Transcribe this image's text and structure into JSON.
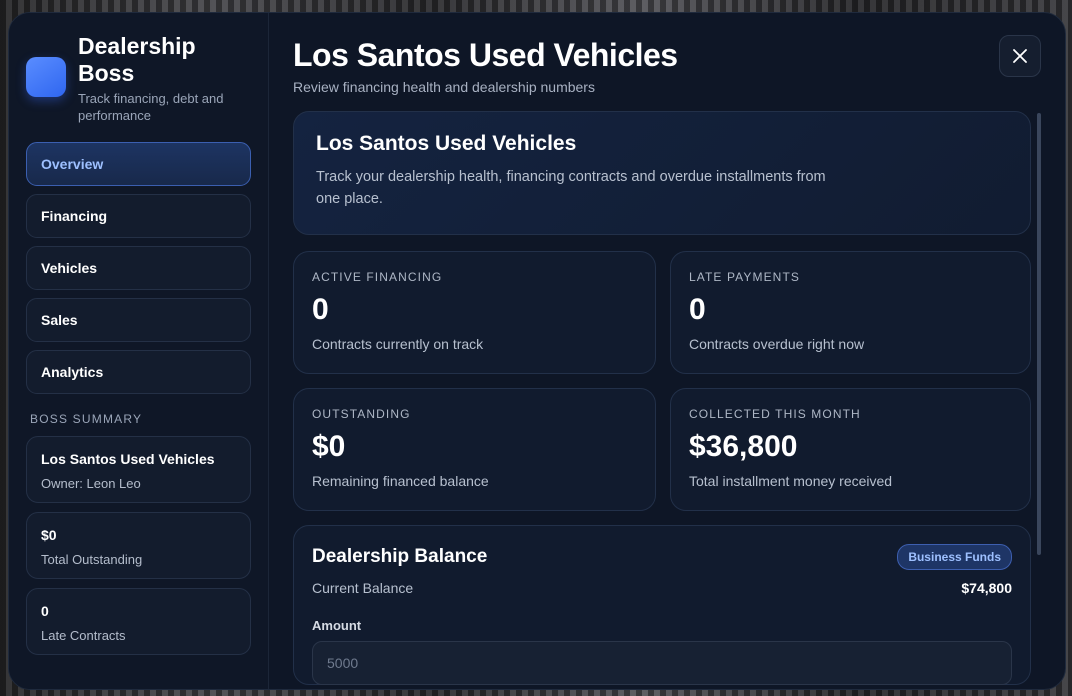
{
  "brand": {
    "title": "Dealership Boss",
    "subtitle": "Track financing, debt and performance"
  },
  "nav": [
    {
      "label": "Overview",
      "active": true
    },
    {
      "label": "Financing",
      "active": false
    },
    {
      "label": "Vehicles",
      "active": false
    },
    {
      "label": "Sales",
      "active": false
    },
    {
      "label": "Analytics",
      "active": false
    }
  ],
  "summary": {
    "label": "BOSS SUMMARY",
    "cards": [
      {
        "big": "Los Santos Used Vehicles",
        "small": "Owner: Leon Leo"
      },
      {
        "big": "$0",
        "small": "Total Outstanding"
      },
      {
        "big": "0",
        "small": "Late Contracts"
      }
    ]
  },
  "header": {
    "title": "Los Santos Used Vehicles",
    "subtitle": "Review financing health and dealership numbers",
    "close_icon": "close-icon"
  },
  "hero": {
    "title": "Los Santos Used Vehicles",
    "description": "Track your dealership health, financing contracts and overdue installments from one place."
  },
  "stats": [
    {
      "label": "ACTIVE FINANCING",
      "value": "0",
      "desc": "Contracts currently on track"
    },
    {
      "label": "LATE PAYMENTS",
      "value": "0",
      "desc": "Contracts overdue right now"
    },
    {
      "label": "OUTSTANDING",
      "value": "$0",
      "desc": "Remaining financed balance"
    },
    {
      "label": "COLLECTED THIS MONTH",
      "value": "$36,800",
      "desc": "Total installment money received"
    }
  ],
  "balance": {
    "title": "Dealership Balance",
    "badge": "Business Funds",
    "current_label": "Current Balance",
    "current_value": "$74,800",
    "amount_label": "Amount",
    "amount_placeholder": "5000"
  },
  "colors": {
    "accent": "#3b6ef5",
    "background": "#0e1626",
    "active_text": "#9ec0ff"
  }
}
